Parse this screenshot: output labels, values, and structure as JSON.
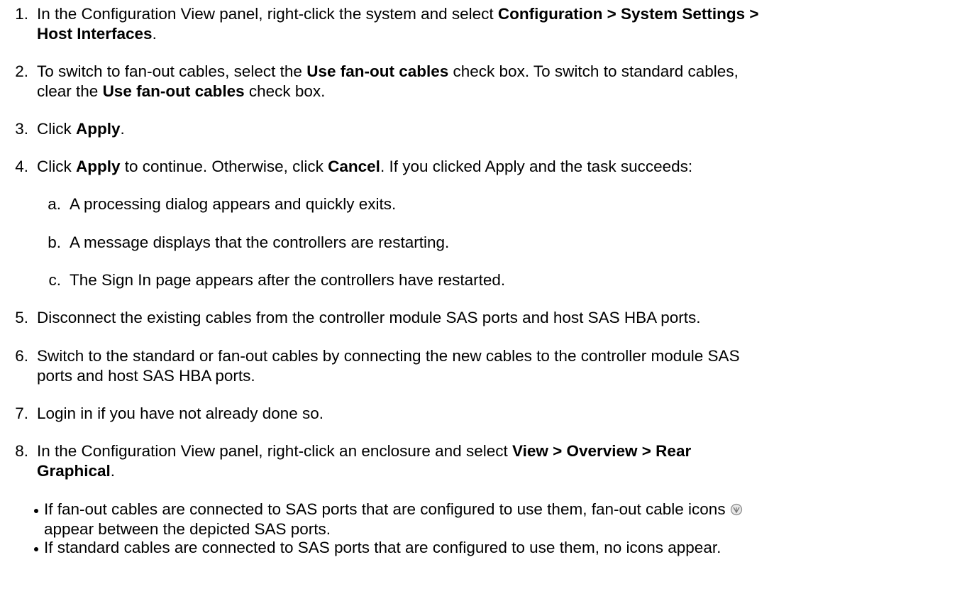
{
  "steps": [
    {
      "number": "1.",
      "text_before": "In the Configuration View panel, right-click the system and select ",
      "bold_1": "Configuration > System Settings >",
      "text_between": "",
      "bold_2": "Host Interfaces",
      "text_after": "."
    },
    {
      "number": "2.",
      "text_1": "To switch to fan-out cables, select the ",
      "bold_1": "Use fan-out cables",
      "text_2": " check box. To switch to standard cables,",
      "text_3": "clear the ",
      "bold_2": "Use fan-out cables",
      "text_4": " check box."
    },
    {
      "number": "3.",
      "text_1": "Click ",
      "bold_1": "Apply",
      "text_2": "."
    },
    {
      "number": "4.",
      "text_1": "Click ",
      "bold_1": "Apply",
      "text_2": " to continue. Otherwise, click ",
      "bold_2": "Cancel",
      "text_3": ". If you clicked Apply and the task succeeds:",
      "substeps": [
        {
          "letter": "a.",
          "text": "A processing dialog appears and quickly exits."
        },
        {
          "letter": "b.",
          "text": "A message displays that the controllers are restarting."
        },
        {
          "letter": "c.",
          "text": "The Sign In page appears after the controllers have restarted."
        }
      ]
    },
    {
      "number": "5.",
      "text": "Disconnect the existing cables from the controller module SAS ports and host SAS HBA ports."
    },
    {
      "number": "6.",
      "text_line1": "Switch to the standard or fan-out cables by connecting the new cables to the controller module SAS",
      "text_line2": "ports and host SAS HBA ports."
    },
    {
      "number": "7.",
      "text": "Login in if you have not already done so."
    },
    {
      "number": "8.",
      "text_1": "In the Configuration View panel, right-click an enclosure and select ",
      "bold_1": "View > Overview > Rear",
      "bold_2": "Graphical",
      "text_2": ".",
      "bullets": [
        {
          "line1": "If fan-out cables are connected to SAS ports that are configured to use them, fan-out cable icons",
          "icon": "fan-out-cable-icon",
          "line2": "appear between the depicted SAS ports."
        },
        {
          "line1": "If standard cables are connected to SAS ports that are configured to use them, no icons appear."
        }
      ]
    }
  ]
}
